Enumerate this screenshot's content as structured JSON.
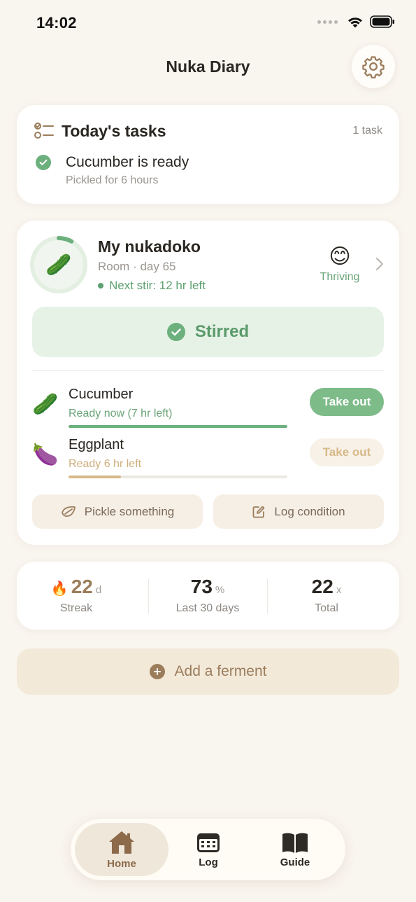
{
  "status_bar": {
    "time": "14:02"
  },
  "header": {
    "title": "Nuka Diary",
    "settings_icon": "gear-icon"
  },
  "tasks": {
    "title": "Today's tasks",
    "count": "1 task",
    "items": [
      {
        "title": "Cucumber is ready",
        "subtitle": "Pickled for 6 hours",
        "done": true
      }
    ]
  },
  "nukadoko": {
    "name": "My nukadoko",
    "meta": "Room · day 65",
    "next_stir": "Next stir: 12 hr left",
    "mood_label": "Thriving",
    "mood_emoji": "😊",
    "avatar_emoji": "🥒",
    "stir_progress": 0.08,
    "stirred_label": "Stirred",
    "pickles": [
      {
        "emoji": "🥒",
        "name": "Cucumber",
        "status": "Ready now (7 hr left)",
        "progress": 1.0,
        "button": "Take out",
        "ready": true
      },
      {
        "emoji": "🍆",
        "name": "Eggplant",
        "status": "Ready 6 hr left",
        "progress": 0.24,
        "button": "Take out",
        "ready": false
      }
    ],
    "actions": {
      "pickle": "Pickle something",
      "log": "Log condition"
    }
  },
  "stats": [
    {
      "value": "22",
      "unit": "d",
      "label": "Streak",
      "icon": "🔥"
    },
    {
      "value": "73",
      "unit": "%",
      "label": "Last 30 days"
    },
    {
      "value": "22",
      "unit": "x",
      "label": "Total"
    }
  ],
  "add_ferment": {
    "label": "Add a ferment"
  },
  "tabs": [
    {
      "label": "Home",
      "icon": "house-icon",
      "active": true
    },
    {
      "label": "Log",
      "icon": "calendar-icon",
      "active": false
    },
    {
      "label": "Guide",
      "icon": "book-icon",
      "active": false
    }
  ],
  "colors": {
    "background": "#f9f5ef",
    "accent_green": "#6cb07d",
    "accent_brown": "#9b7d5c",
    "pending_bar": "#d7b989"
  }
}
